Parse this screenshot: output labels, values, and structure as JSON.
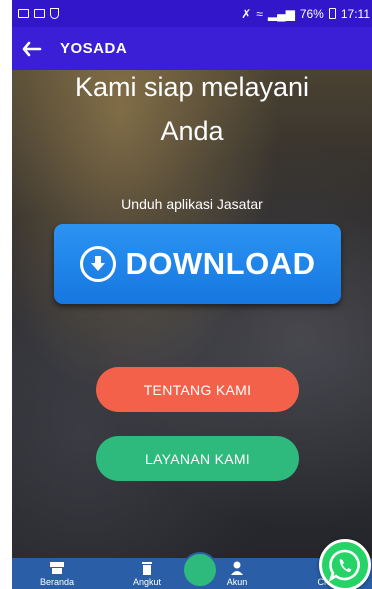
{
  "status_bar": {
    "battery": "76%",
    "time": "17:11"
  },
  "app_bar": {
    "title": "YOSADA"
  },
  "hero": {
    "headline_line1": "Kami siap melayani",
    "headline_line2": "Anda",
    "subtitle": "Unduh aplikasi Jasatar",
    "download_label": "DOWNLOAD"
  },
  "buttons": {
    "tentang_label": "TENTANG KAMI",
    "layanan_label": "LAYANAN KAMI"
  },
  "bottom_nav": {
    "items": [
      {
        "label": "Beranda",
        "icon": "store-icon"
      },
      {
        "label": "Angkut",
        "icon": "trash-icon"
      },
      {
        "label": "Akun",
        "icon": "person-icon"
      },
      {
        "label": "Chat",
        "icon": "whatsapp-icon"
      }
    ]
  },
  "colors": {
    "status_bar": "#3216c9",
    "app_bar": "#3a1fd6",
    "download": "#1a80e8",
    "tentang": "#f4614a",
    "layanan": "#2eba7c",
    "bottom_nav": "#2a5fa8",
    "whatsapp": "#25d366"
  }
}
